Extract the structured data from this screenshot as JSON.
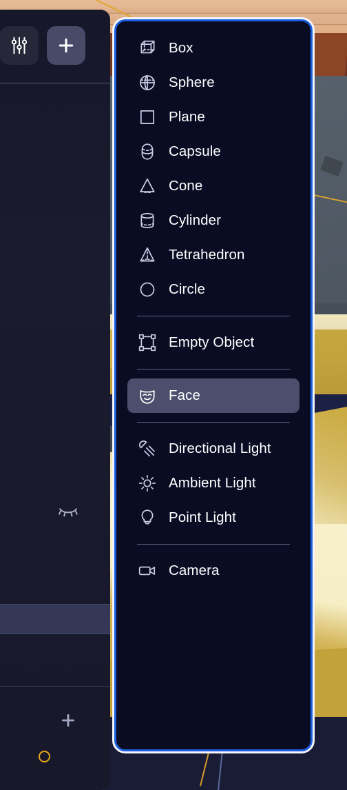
{
  "app": {
    "kind": "3d-scene-editor",
    "accent_blue": "#1c5fe0",
    "menu_bg": "#0a0c24",
    "selected_row_bg": "#4b4f6d",
    "panel_bg": "#17182a",
    "icon_color": "#c9cde4",
    "text_color": "#ffffff",
    "marker_orange": "#e8a61f"
  },
  "left_panel": {
    "name": "outliner-panel",
    "toolbar": {
      "settings_button": {
        "label": "",
        "icon": "sliders-icon"
      },
      "add_button": {
        "label": "+",
        "icon": "plus-icon",
        "active": true
      }
    },
    "rows": [
      {
        "name": "visibility-row",
        "icon": "eye-off-icon"
      },
      {
        "name": "selected-row",
        "selected": true
      },
      {
        "name": "add-row",
        "icon": "plus-icon"
      },
      {
        "name": "marker-row",
        "icon": "circle-marker-icon"
      }
    ]
  },
  "add_menu": {
    "name": "add-object-menu",
    "groups": [
      {
        "name": "primitives",
        "items": [
          {
            "label": "Box",
            "icon": "box-icon"
          },
          {
            "label": "Sphere",
            "icon": "sphere-icon"
          },
          {
            "label": "Plane",
            "icon": "plane-icon"
          },
          {
            "label": "Capsule",
            "icon": "capsule-icon"
          },
          {
            "label": "Cone",
            "icon": "cone-icon"
          },
          {
            "label": "Cylinder",
            "icon": "cylinder-icon"
          },
          {
            "label": "Tetrahedron",
            "icon": "tetrahedron-icon"
          },
          {
            "label": "Circle",
            "icon": "circle-icon"
          }
        ]
      },
      {
        "name": "empties",
        "items": [
          {
            "label": "Empty Object",
            "icon": "empty-object-icon"
          }
        ]
      },
      {
        "name": "characters",
        "items": [
          {
            "label": "Face",
            "icon": "face-icon",
            "selected": true
          }
        ]
      },
      {
        "name": "lights",
        "items": [
          {
            "label": "Directional Light",
            "icon": "directional-light-icon"
          },
          {
            "label": "Ambient Light",
            "icon": "ambient-light-icon"
          },
          {
            "label": "Point Light",
            "icon": "point-light-icon"
          }
        ]
      },
      {
        "name": "cameras",
        "items": [
          {
            "label": "Camera",
            "icon": "camera-icon"
          }
        ]
      }
    ]
  },
  "viewport": {
    "name": "3d-viewport",
    "description": "3D scene background with wooden plank ceiling, grey wall and golden floor surfaces"
  }
}
